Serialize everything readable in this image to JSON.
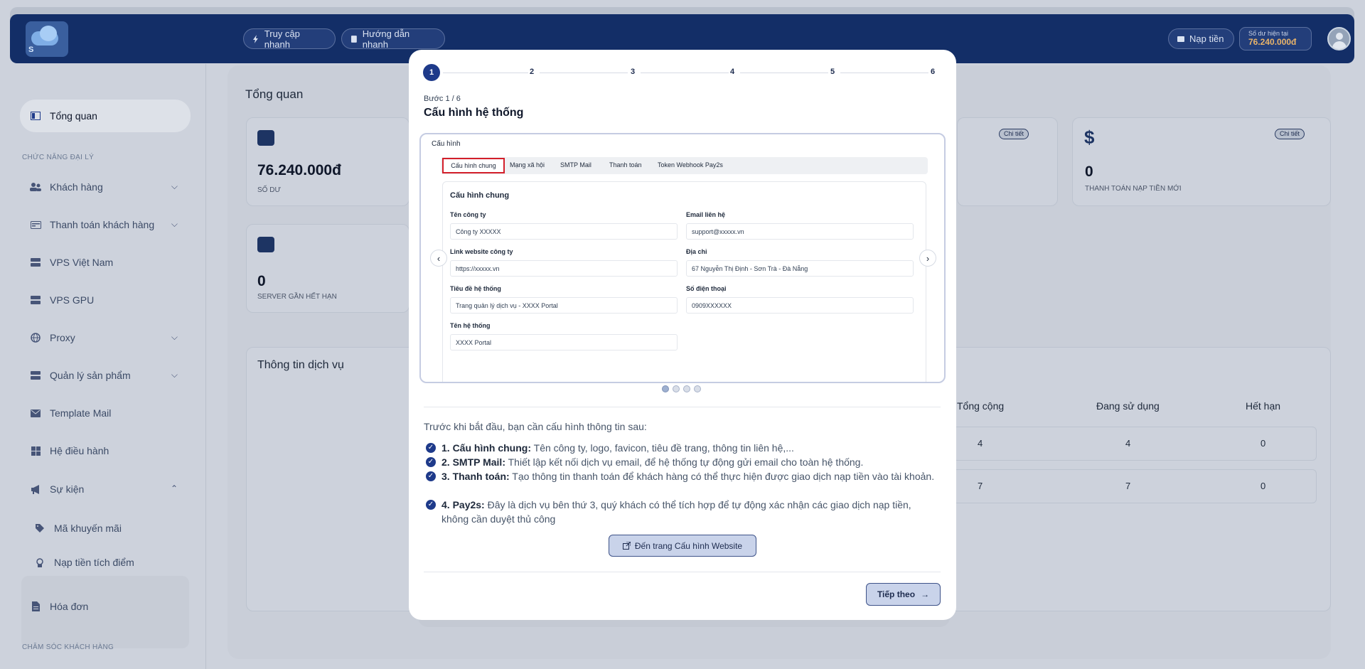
{
  "topbar": {
    "logo_letter": "S",
    "quick_access": "Truy cập nhanh",
    "quick_guide": "Hướng dẫn nhanh",
    "topup": "Nạp tiền",
    "balance_label": "Số dư hiện tại",
    "balance_value": "76.240.000đ"
  },
  "sidebar": {
    "overview": "Tổng quan",
    "section_agent": "CHỨC NĂNG ĐẠI LÝ",
    "items": [
      {
        "label": "Khách hàng",
        "icon": "users-icon"
      },
      {
        "label": "Thanh toán khách hàng",
        "icon": "card-icon"
      },
      {
        "label": "VPS Việt Nam",
        "icon": "server-icon"
      },
      {
        "label": "VPS GPU",
        "icon": "server-icon"
      },
      {
        "label": "Proxy",
        "icon": "globe-icon"
      },
      {
        "label": "Quản lý sản phẩm",
        "icon": "server-icon"
      },
      {
        "label": "Template Mail",
        "icon": "mail-icon"
      },
      {
        "label": "Hệ điều hành",
        "icon": "windows-icon"
      },
      {
        "label": "Sự kiện",
        "icon": "megaphone-icon"
      }
    ],
    "sub_items": [
      "Mã khuyến mãi",
      "Nạp tiền tích điểm"
    ],
    "invoice": "Hóa đơn",
    "section_care": "CHĂM SÓC KHÁCH HÀNG"
  },
  "main": {
    "title": "Tổng quan",
    "balance_card": {
      "value": "76.240.000đ",
      "label": "SỐ DƯ"
    },
    "expiring_card": {
      "value": "0",
      "label": "SERVER GẦN HẾT HẠN"
    },
    "payment_card": {
      "value": "0",
      "label": "THANH TOÁN NẠP TIỀN MỚI",
      "chip": "Chi tiết"
    },
    "chip_detail": "Chi tiết",
    "service_title": "Thông tin dịch vụ",
    "table_headers": [
      "Tổng cộng",
      "Đang sử dụng",
      "Hết hạn"
    ],
    "table_rows": [
      [
        "4",
        "4",
        "0"
      ],
      [
        "7",
        "7",
        "0"
      ]
    ]
  },
  "modal": {
    "steps": [
      "1",
      "2",
      "3",
      "4",
      "5",
      "6"
    ],
    "step_label": "Bước 1 / 6",
    "title": "Cấu hình hệ thống",
    "preview": {
      "heading": "Cấu hình",
      "tabs": [
        "Cấu hình chung",
        "Mạng xã hội",
        "SMTP Mail",
        "Thanh toán",
        "Token Webhook Pay2s"
      ],
      "form_title": "Cấu hình chung",
      "fields": {
        "company_name": {
          "label": "Tên công ty",
          "value": "Công ty XXXXX"
        },
        "contact_email": {
          "label": "Email liên hệ",
          "value": "support@xxxxx.vn"
        },
        "website": {
          "label": "Link website công ty",
          "value": "https://xxxxx.vn"
        },
        "address": {
          "label": "Địa chỉ",
          "value": "67 Nguyễn Thị Định - Sơn Trà - Đà Nẵng"
        },
        "system_title": {
          "label": "Tiêu đề hệ thống",
          "value": "Trang quản lý dịch vụ - XXXX Portal"
        },
        "phone": {
          "label": "Số điện thoại",
          "value": "0909XXXXXX"
        },
        "system_name": {
          "label": "Tên hệ thống",
          "value": "XXXX Portal"
        }
      }
    },
    "intro": "Trước khi bắt đầu, bạn cần cấu hình thông tin sau:",
    "items": [
      {
        "bold": "1. Cấu hình chung:",
        "text": " Tên công ty, logo, favicon, tiêu đề trang, thông tin liên hệ,..."
      },
      {
        "bold": "2. SMTP Mail:",
        "text": " Thiết lập kết nối dịch vụ email, để hệ thống tự động gửi email cho toàn hệ thống."
      },
      {
        "bold": "3. Thanh toán:",
        "text": " Tạo thông tin thanh toán để khách hàng có thể thực hiện được giao dịch nạp tiền vào tài khoản."
      },
      {
        "bold": "4. Pay2s:",
        "text": " Đây là dịch vụ bên thứ 3, quý khách có thể tích hợp để tự động xác nhận các giao dịch nạp tiền, không cần duyệt thủ công"
      }
    ],
    "config_button": "Đến trang Cấu hình Website",
    "next_button": "Tiếp theo"
  }
}
